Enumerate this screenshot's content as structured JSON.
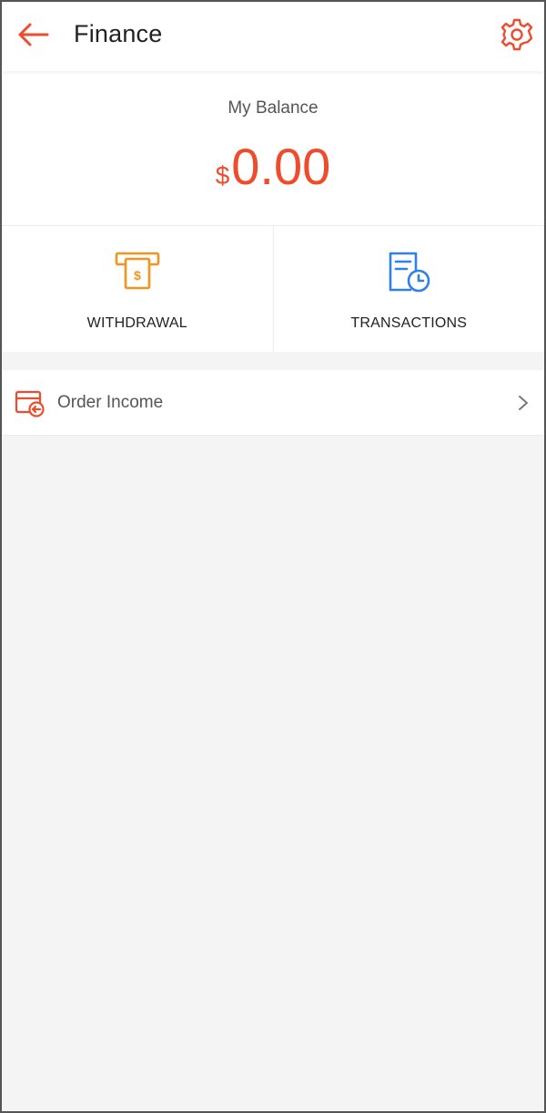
{
  "header": {
    "title": "Finance",
    "back_icon": "arrow-left-icon",
    "settings_icon": "gear-icon"
  },
  "balance": {
    "label": "My Balance",
    "currency": "$",
    "amount": "0.00"
  },
  "actions": [
    {
      "label": "WITHDRAWAL",
      "icon": "atm-withdrawal-icon",
      "color": "#f6921e"
    },
    {
      "label": "TRANSACTIONS",
      "icon": "document-clock-icon",
      "color": "#2f80ed"
    }
  ],
  "list": {
    "items": [
      {
        "label": "Order Income",
        "icon": "wallet-arrow-icon"
      }
    ]
  },
  "colors": {
    "accent": "#ee4d2d",
    "background": "#f4f4f4",
    "text": "#222222",
    "muted": "#555555"
  }
}
